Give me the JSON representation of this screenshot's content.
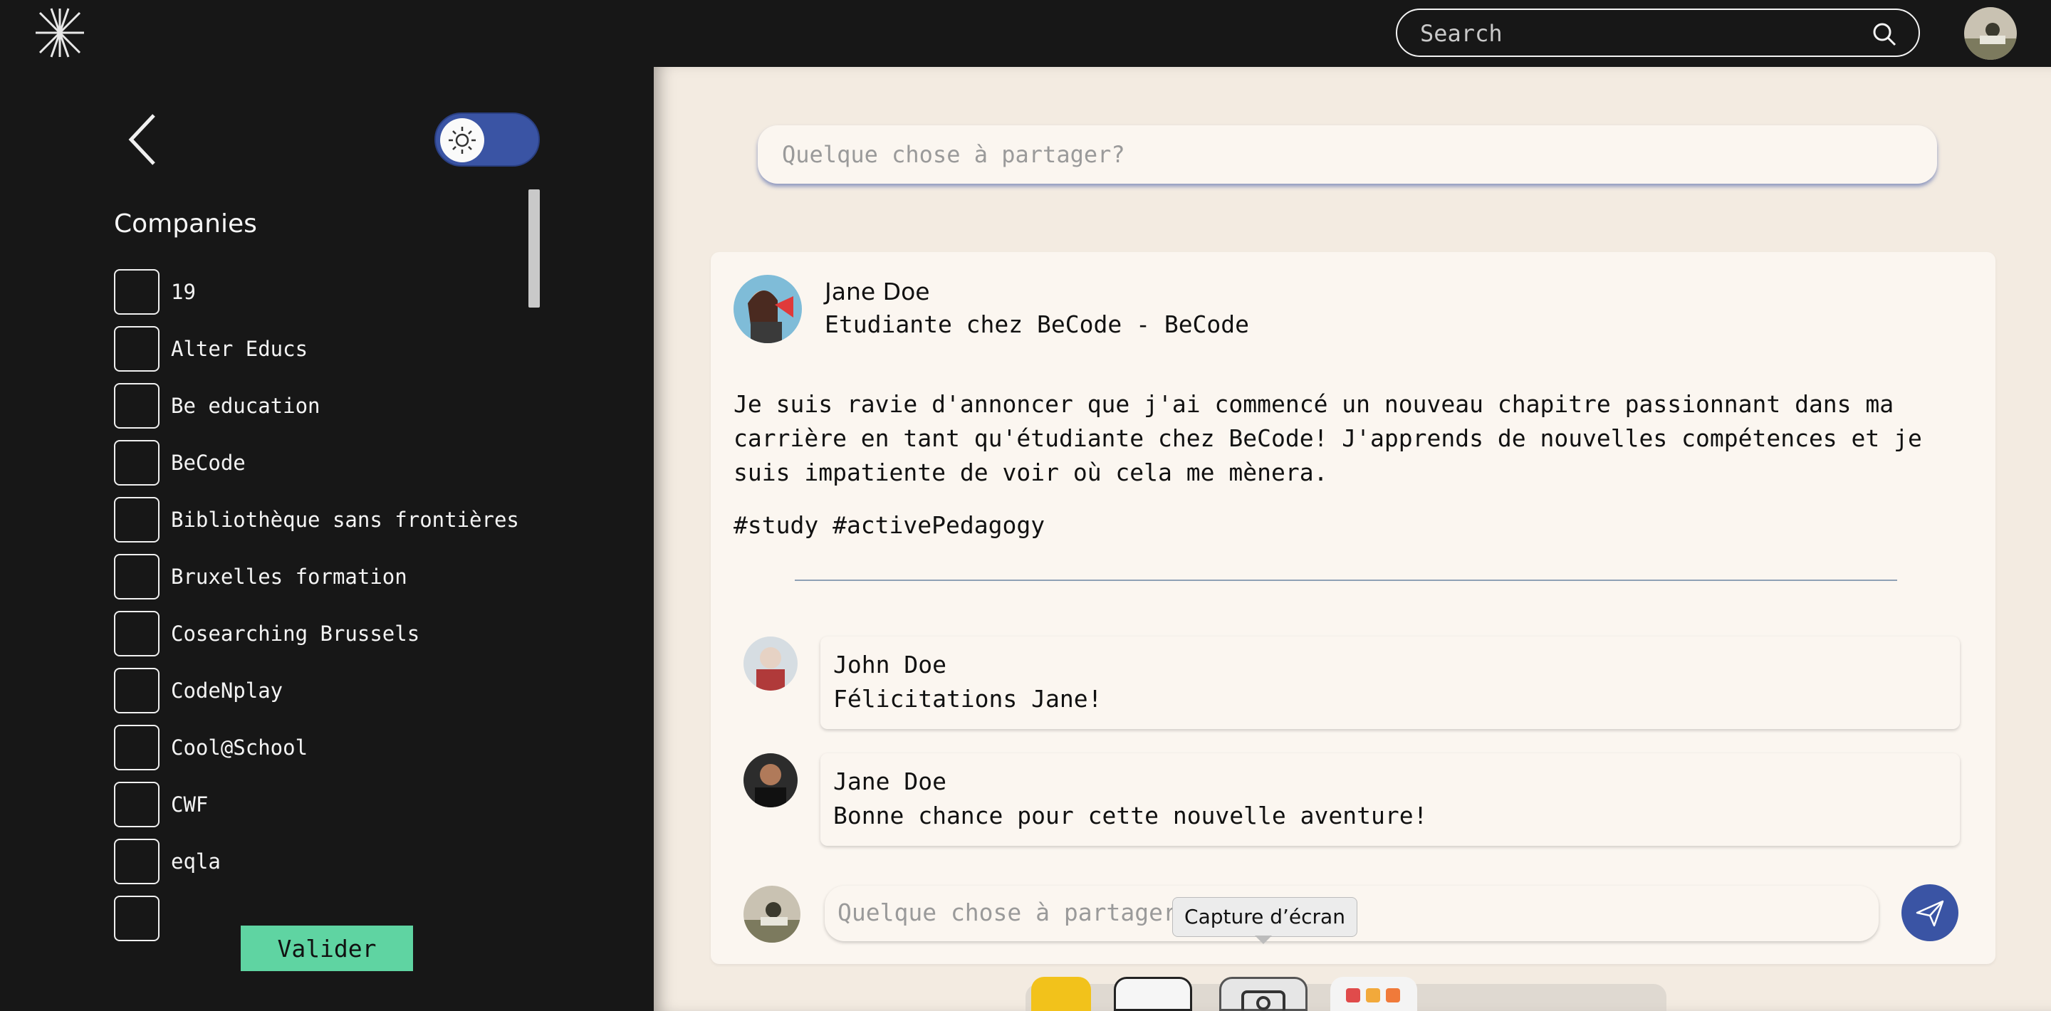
{
  "header": {
    "search_placeholder": "Search",
    "logo": "brand-logo-icon",
    "user_avatar": "user-avatar"
  },
  "sidebar": {
    "back_icon": "chevron-left-icon",
    "theme_toggle": {
      "icon": "sun-icon",
      "state": "light"
    },
    "title": "Companies",
    "companies": [
      "19",
      "Alter Educs",
      "Be education",
      "BeCode",
      "Bibliothèque sans frontières",
      "Bruxelles formation",
      "Cosearching Brussels",
      "CodeNplay",
      "Cool@School",
      "CWF",
      "eqla",
      ""
    ],
    "validate_label": "Valider"
  },
  "main": {
    "share_placeholder": "Quelque chose à partager?",
    "post": {
      "author": "Jane Doe",
      "role": "Etudiante chez BeCode - BeCode",
      "body": "Je suis ravie d'annoncer que j'ai commencé un nouveau chapitre passionnant dans ma carrière en tant qu'étudiante chez BeCode! J'apprends de nouvelles compétences et je suis impatiente de voir où cela me mènera.",
      "tags": "#study #activePedagogy",
      "comments": [
        {
          "author": "John Doe",
          "text": "Félicitations Jane!"
        },
        {
          "author": "Jane Doe",
          "text": "Bonne chance pour cette nouvelle aventure!"
        }
      ],
      "reply_placeholder": "Quelque chose à partager?",
      "send_icon": "send-icon"
    }
  },
  "tooltip": {
    "text": "Capture d’écran"
  },
  "colors": {
    "background_dark": "#171717",
    "main_bg": "#f3ebe1",
    "card_bg": "#fbf6f0",
    "accent_blue": "#3a54a4",
    "validate_green": "#5fd4a2"
  }
}
